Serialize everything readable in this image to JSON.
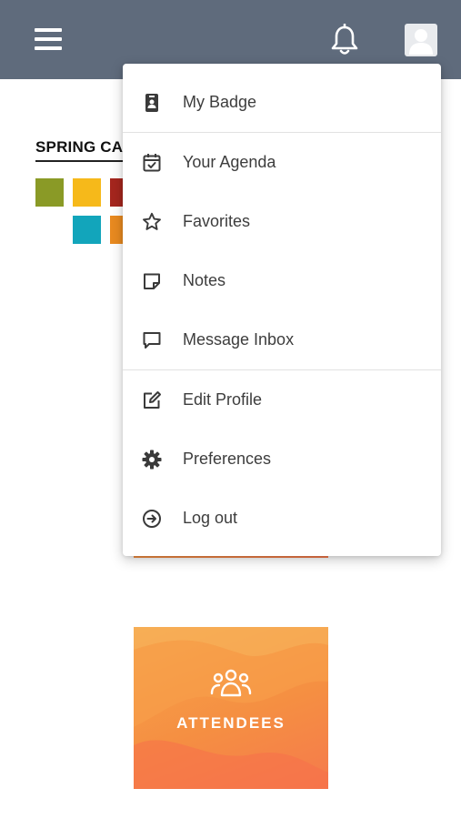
{
  "header": {
    "menu_icon": "hamburger-icon",
    "notification_icon": "bell-icon",
    "avatar_icon": "user-avatar-icon",
    "background_color": "#5f6b7c"
  },
  "page": {
    "brand_text": "SPRING CA",
    "palette": [
      "#8a9a26",
      "#f6b91a",
      "#a5261e",
      "#12a5bb",
      "#e98a20"
    ],
    "tiles": [
      {
        "label": "ATTENDEES",
        "icon": "people-group-icon"
      }
    ]
  },
  "dropdown": {
    "items": [
      {
        "label": "My Badge",
        "icon": "badge-icon"
      },
      {
        "label": "Your Agenda",
        "icon": "calendar-check-icon"
      },
      {
        "label": "Favorites",
        "icon": "star-icon"
      },
      {
        "label": "Notes",
        "icon": "note-icon"
      },
      {
        "label": "Message Inbox",
        "icon": "chat-bubble-icon"
      },
      {
        "label": "Edit Profile",
        "icon": "edit-icon"
      },
      {
        "label": "Preferences",
        "icon": "gear-icon"
      },
      {
        "label": "Log out",
        "icon": "logout-icon"
      }
    ]
  }
}
